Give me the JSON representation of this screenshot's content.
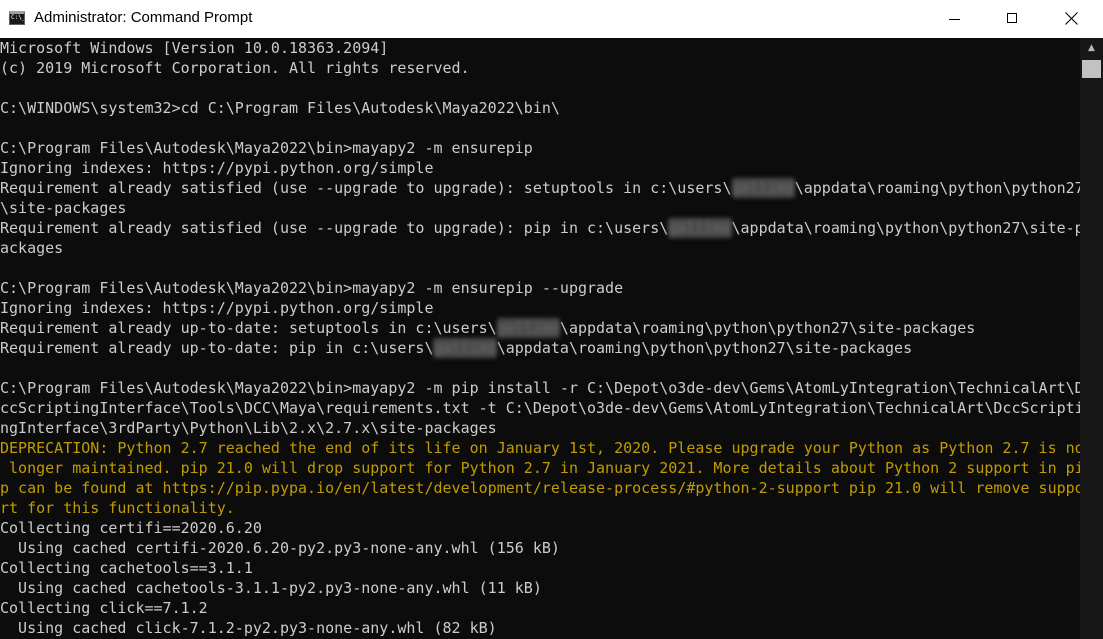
{
  "window": {
    "title": "Administrator: Command Prompt",
    "icon": "command-prompt-icon",
    "icon_text": "C:\\_",
    "controls": {
      "minimize": "minimize-icon",
      "maximize": "maximize-icon",
      "close": "close-icon"
    },
    "colors": {
      "background": "#0c0c0c",
      "text": "#cccccc",
      "warning": "#c19c00",
      "titlebar": "#ffffff"
    }
  },
  "scrollbar": {
    "up_arrow": "▲"
  },
  "console": {
    "lines": [
      {
        "text": "Microsoft Windows [Version 10.0.18363.2094]"
      },
      {
        "text": "(c) 2019 Microsoft Corporation. All rights reserved."
      },
      {
        "text": ""
      },
      {
        "text": "C:\\WINDOWS\\system32>cd C:\\Program Files\\Autodesk\\Maya2022\\bin\\"
      },
      {
        "text": ""
      },
      {
        "text": "C:\\Program Files\\Autodesk\\Maya2022\\bin>mayapy2 -m ensurepip"
      },
      {
        "text": "Ignoring indexes: https://pypi.python.org/simple"
      },
      {
        "before": "Requirement already satisfied (use --upgrade to upgrade): setuptools in c:\\users\\",
        "redacted": "gallimd",
        "after": "\\appdata\\roaming\\python\\python27"
      },
      {
        "text": "\\site-packages"
      },
      {
        "before": "Requirement already satisfied (use --upgrade to upgrade): pip in c:\\users\\",
        "redacted": "gallimd",
        "after": "\\appdata\\roaming\\python\\python27\\site-p"
      },
      {
        "text": "ackages"
      },
      {
        "text": ""
      },
      {
        "text": "C:\\Program Files\\Autodesk\\Maya2022\\bin>mayapy2 -m ensurepip --upgrade"
      },
      {
        "text": "Ignoring indexes: https://pypi.python.org/simple"
      },
      {
        "before": "Requirement already up-to-date: setuptools in c:\\users\\",
        "redacted": "gallimd",
        "after": "\\appdata\\roaming\\python\\python27\\site-packages"
      },
      {
        "before": "Requirement already up-to-date: pip in c:\\users\\",
        "redacted": "gallimd",
        "after": "\\appdata\\roaming\\python\\python27\\site-packages"
      },
      {
        "text": ""
      },
      {
        "text": "C:\\Program Files\\Autodesk\\Maya2022\\bin>mayapy2 -m pip install -r C:\\Depot\\o3de-dev\\Gems\\AtomLyIntegration\\TechnicalArt\\D"
      },
      {
        "text": "ccScriptingInterface\\Tools\\DCC\\Maya\\requirements.txt -t C:\\Depot\\o3de-dev\\Gems\\AtomLyIntegration\\TechnicalArt\\DccScripti"
      },
      {
        "text": "ngInterface\\3rdParty\\Python\\Lib\\2.x\\2.7.x\\site-packages"
      },
      {
        "text": "DEPRECATION: Python 2.7 reached the end of its life on January 1st, 2020. Please upgrade your Python as Python 2.7 is no",
        "style": "warn"
      },
      {
        "text": " longer maintained. pip 21.0 will drop support for Python 2.7 in January 2021. More details about Python 2 support in pi",
        "style": "warn"
      },
      {
        "text": "p can be found at https://pip.pypa.io/en/latest/development/release-process/#python-2-support pip 21.0 will remove suppo",
        "style": "warn"
      },
      {
        "text": "rt for this functionality.",
        "style": "warn"
      },
      {
        "text": "Collecting certifi==2020.6.20"
      },
      {
        "text": "  Using cached certifi-2020.6.20-py2.py3-none-any.whl (156 kB)"
      },
      {
        "text": "Collecting cachetools==3.1.1"
      },
      {
        "text": "  Using cached cachetools-3.1.1-py2.py3-none-any.whl (11 kB)"
      },
      {
        "text": "Collecting click==7.1.2"
      },
      {
        "text": "  Using cached click-7.1.2-py2.py3-none-any.whl (82 kB)"
      }
    ]
  }
}
